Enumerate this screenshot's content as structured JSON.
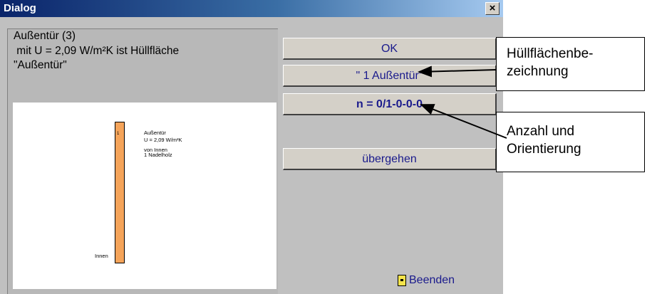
{
  "window": {
    "title": "Dialog",
    "close_label": "×"
  },
  "info": {
    "line1": "Außentür (3)",
    "line2": " mit U = 2,09 W/m²K ist Hüllfläche",
    "line3": "\"Außentür\""
  },
  "drawing": {
    "layer_number": "1",
    "element_name": "Außentür",
    "u_value": "U = 2,09 W/m²K",
    "direction": "von Innen",
    "material": "1 Nadelholz",
    "inside_label": "Innen",
    "layer_color": "#f5a45a"
  },
  "buttons": {
    "ok": "OK",
    "name": "\"  1 Außentür\"",
    "count": "n = 0/1-0-0-0",
    "skip": "übergehen",
    "end": "Beenden"
  },
  "callouts": {
    "c1_line1": "Hüllflächenbe-",
    "c1_line2": "zeichnung",
    "c2_line1": "Anzahl und",
    "c2_line2": "Orientierung"
  },
  "colors": {
    "button_text": "#1a1a8c",
    "dialog_bg": "#c0c0c0",
    "titlebar": "#0a246a"
  }
}
